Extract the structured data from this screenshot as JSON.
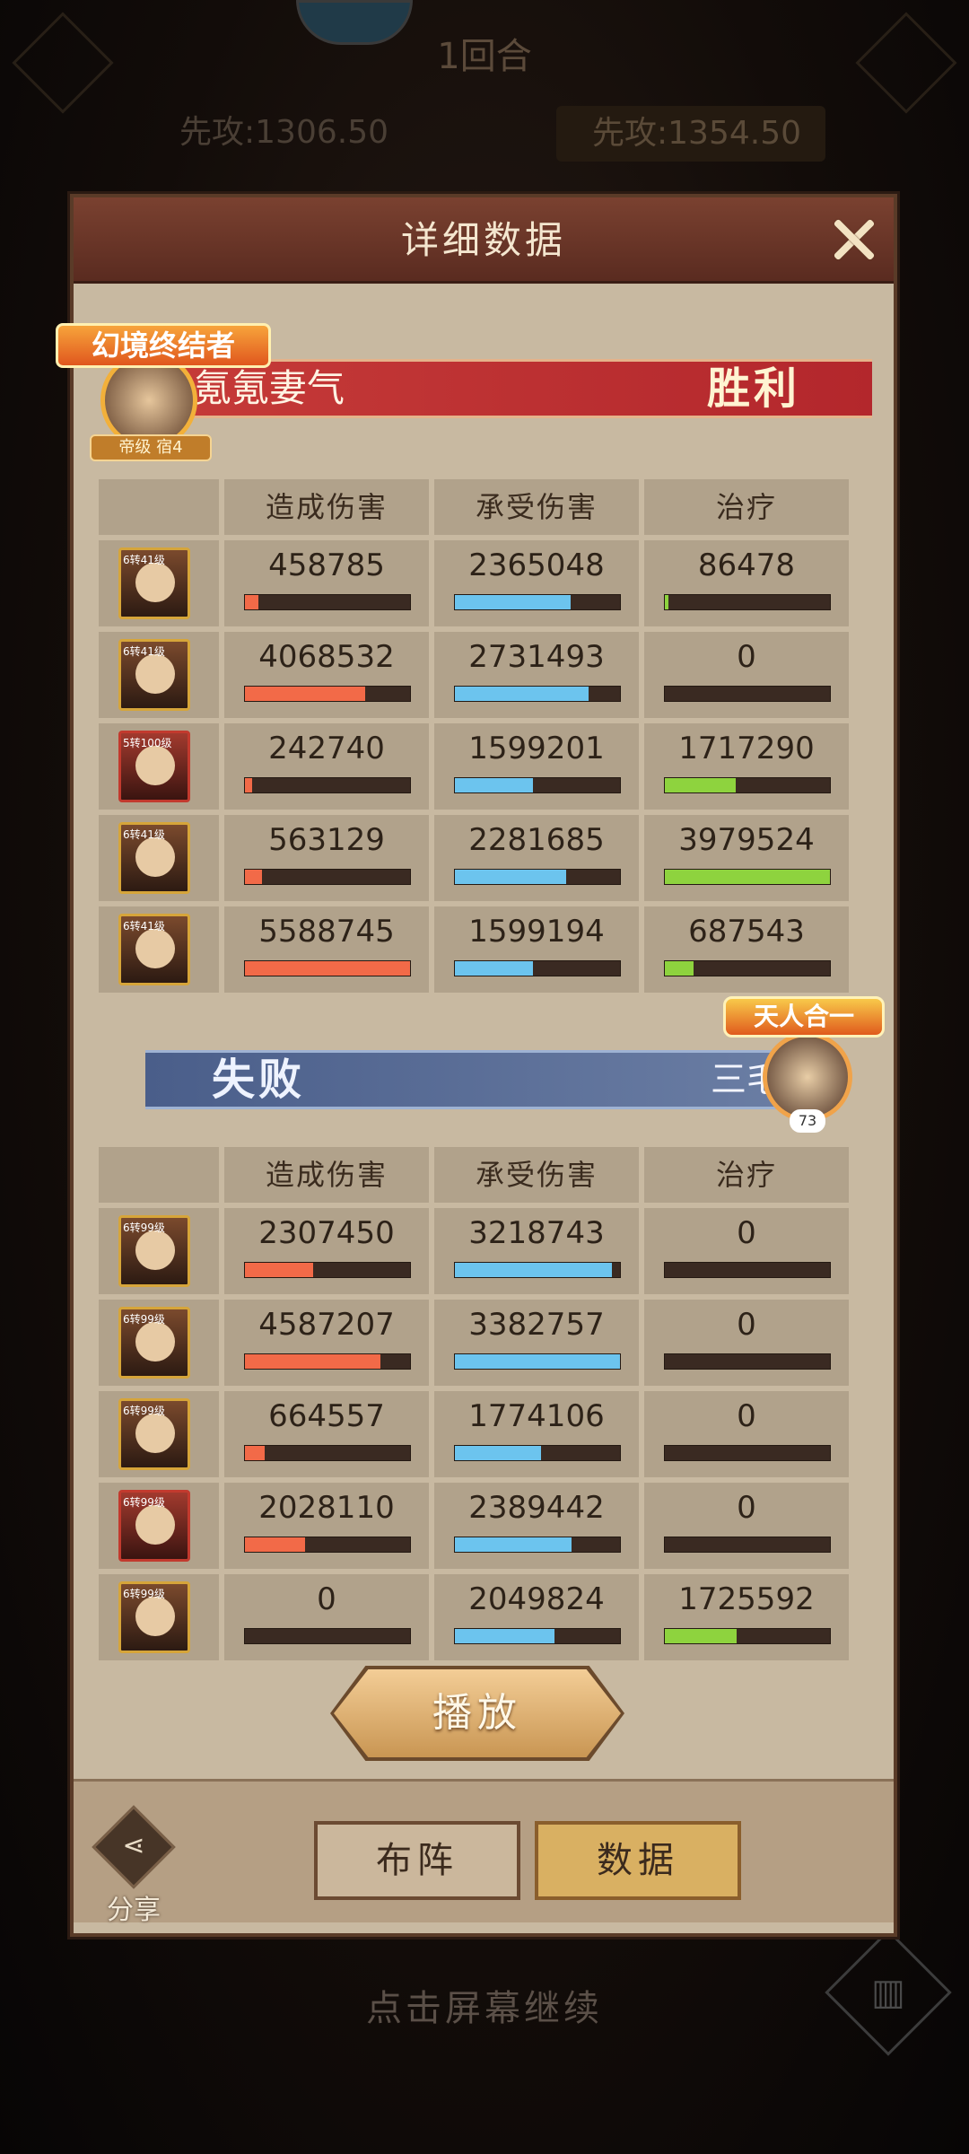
{
  "background": {
    "round_label": "1回合",
    "attack_left": "先攻:1306.50",
    "attack_right": "先攻:1354.50",
    "continue_hint": "点击屏幕继续",
    "stats_icon": "bar-chart-icon"
  },
  "modal": {
    "title": "详细数据",
    "close_icon": "close-icon"
  },
  "columns": [
    "造成伤害",
    "承受伤害",
    "治疗"
  ],
  "team_win": {
    "title_badge": "幻境终结者",
    "player_name": "氪氪妻气",
    "avatar_label": "帝级 宿4",
    "result": "胜利",
    "heroes": [
      {
        "level": "6转41级",
        "damage": "458785",
        "taken": "2365048",
        "heal": "86478"
      },
      {
        "level": "6转41级",
        "damage": "4068532",
        "taken": "2731493",
        "heal": "0"
      },
      {
        "level": "5转100级",
        "damage": "242740",
        "taken": "1599201",
        "heal": "1717290"
      },
      {
        "level": "6转41级",
        "damage": "563129",
        "taken": "2281685",
        "heal": "3979524"
      },
      {
        "level": "6转41级",
        "damage": "5588745",
        "taken": "1599194",
        "heal": "687543"
      }
    ]
  },
  "team_lose": {
    "title_badge": "天人合一",
    "player_name": "三毛",
    "avatar_level": "73",
    "result": "失败",
    "heroes": [
      {
        "level": "6转99级",
        "damage": "2307450",
        "taken": "3218743",
        "heal": "0"
      },
      {
        "level": "6转99级",
        "damage": "4587207",
        "taken": "3382757",
        "heal": "0"
      },
      {
        "level": "6转99级",
        "damage": "664557",
        "taken": "1774106",
        "heal": "0"
      },
      {
        "level": "6转99级",
        "damage": "2028110",
        "taken": "2389442",
        "heal": "0"
      },
      {
        "level": "6转99级",
        "damage": "0",
        "taken": "2049824",
        "heal": "1725592"
      }
    ]
  },
  "bar_scale": {
    "damage_max": 5588745,
    "taken_max": 3382757,
    "heal_max": 3979524
  },
  "play_button": "播放",
  "footer": {
    "share_label": "分享",
    "share_icon": "share-icon",
    "lineup_label": "布阵",
    "data_label": "数据"
  },
  "colors": {
    "damage": "#f26a48",
    "taken": "#6cc4ee",
    "heal": "#8ed33e"
  }
}
